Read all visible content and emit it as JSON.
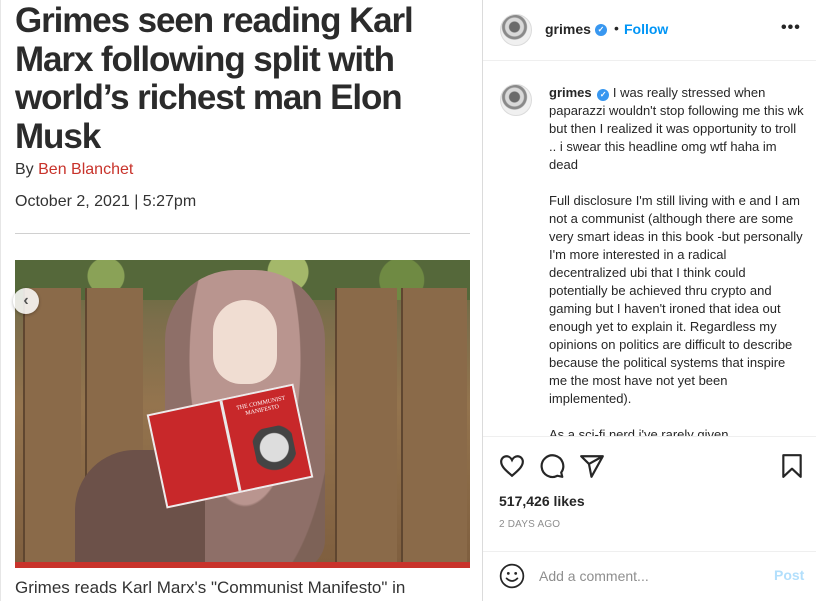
{
  "article": {
    "headline": "Grimes seen reading Karl Marx following split with world’s richest man Elon Musk",
    "byline_prefix": "By ",
    "author": "Ben Blanchet",
    "dateline": "October 2, 2021 | 5:27pm",
    "photo_nav_icon": "chevron-left-icon",
    "photo_nav_glyph": "‹",
    "book_title": "THE COMMUNIST MANIFESTO",
    "caption": "Grimes reads Karl Marx's \"Communist Manifesto\" in"
  },
  "post": {
    "username": "grimes",
    "verified_glyph": "✓",
    "dot": "•",
    "follow_label": "Follow",
    "more_label": "•••",
    "comment": {
      "username": "grimes",
      "paragraph1": "I was really stressed when paparazzi wouldn't stop following me this wk but then I realized it was opportunity to troll .. i swear this headline omg wtf haha im dead",
      "paragraph2": "Full disclosure I'm still living with e and I am not a communist (although there are some very smart ideas in this book -but personally I'm more interested in a radical decentralized ubi that I think could potentially be achieved thru crypto and gaming but I haven't ironed that idea out enough yet to explain it. Regardless my opinions on politics are difficult to describe because the political systems that inspire me the most have not yet been implemented).",
      "paragraph3_partial": "As a sci-fi nerd i've rarely given"
    },
    "icons": {
      "like": "heart-icon",
      "comment": "comment-icon",
      "share": "share-icon",
      "save": "bookmark-icon",
      "emoji": "emoji-icon"
    },
    "likes": "517,426 likes",
    "time_ago": "2 DAYS AGO",
    "comment_placeholder": "Add a comment...",
    "post_label": "Post",
    "colors": {
      "link_blue": "#0095f6",
      "post_disabled": "#b2dffc",
      "author_red": "#c8332b",
      "verified": "#3897f0"
    }
  }
}
